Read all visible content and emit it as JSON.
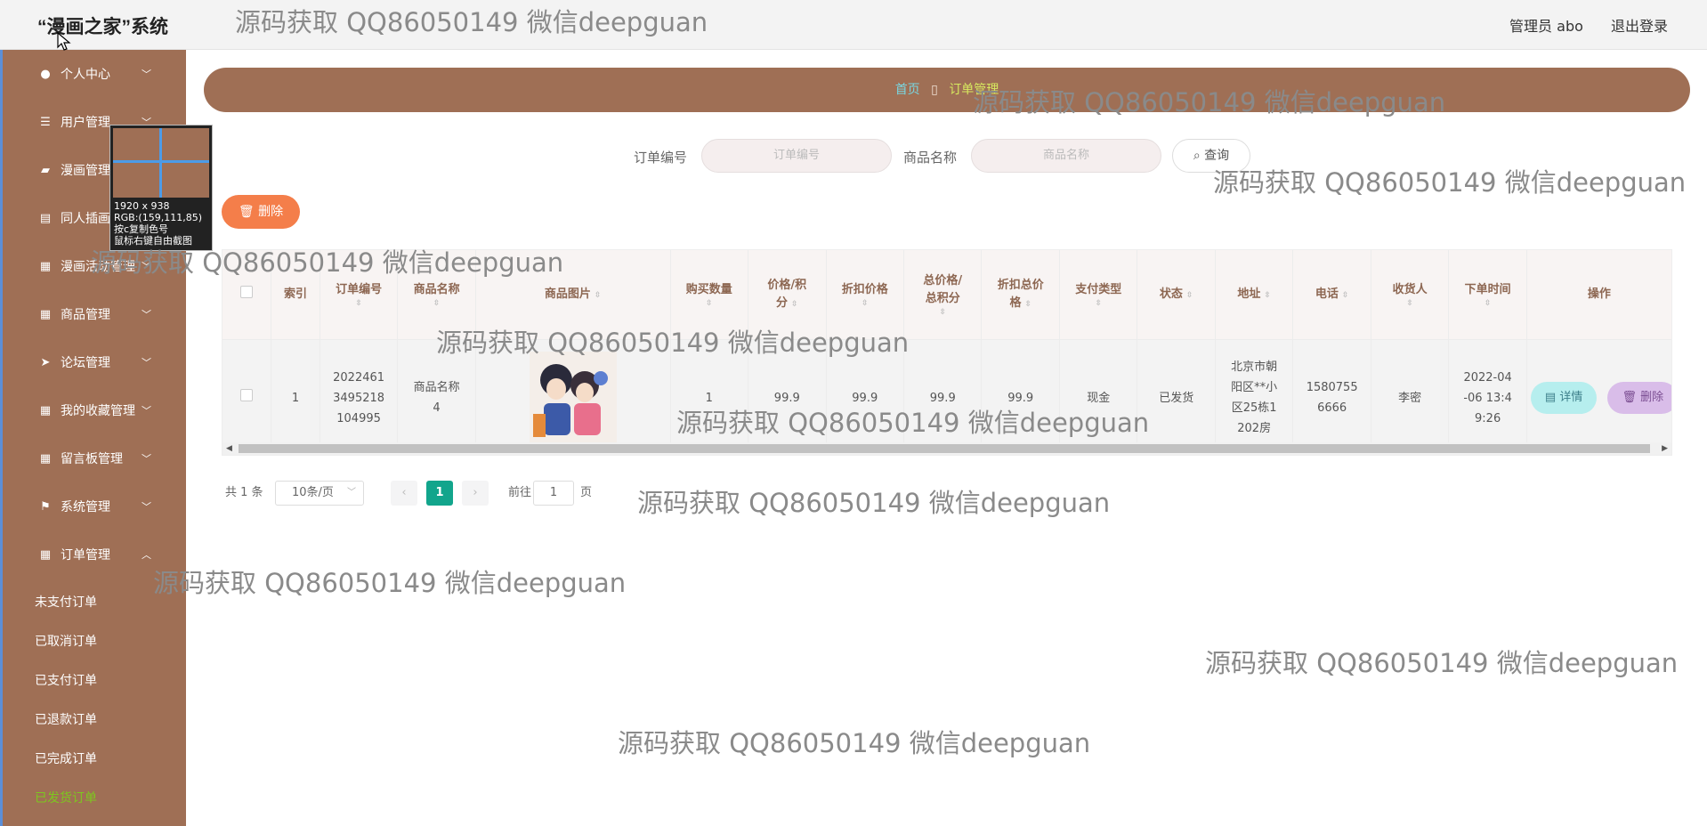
{
  "header": {
    "title": "“漫画之家”系统",
    "user": "管理员 abo",
    "logout": "退出登录"
  },
  "sidebar": {
    "items": [
      {
        "label": "个人中心",
        "icon": "user-icon"
      },
      {
        "label": "用户管理",
        "icon": "sliders-icon"
      },
      {
        "label": "漫画管理",
        "icon": "bookmark-icon"
      },
      {
        "label": "同人插画",
        "icon": "briefcase-icon"
      },
      {
        "label": "漫画活动管理",
        "icon": "grid-icon"
      },
      {
        "label": "商品管理",
        "icon": "grid-icon"
      },
      {
        "label": "论坛管理",
        "icon": "send-icon"
      },
      {
        "label": "我的收藏管理",
        "icon": "grid-icon"
      },
      {
        "label": "留言板管理",
        "icon": "grid-icon"
      },
      {
        "label": "系统管理",
        "icon": "flag-icon"
      },
      {
        "label": "订单管理",
        "icon": "grid-icon"
      }
    ],
    "sub_items": [
      "未支付订单",
      "已取消订单",
      "已支付订单",
      "已退款订单",
      "已完成订单",
      "已发货订单"
    ]
  },
  "tooltip": {
    "size": "1920 x 938",
    "rgb": "RGB:(159,111,85)",
    "hint1": "按c复制色号",
    "hint2": "鼠标右键自由截图"
  },
  "breadcrumb": {
    "home": "首页",
    "sep": "▯",
    "current": "订单管理"
  },
  "search": {
    "order_label": "订单编号",
    "order_placeholder": "订单编号",
    "product_label": "商品名称",
    "product_placeholder": "商品名称",
    "button": "查询"
  },
  "toolbar": {
    "delete": "删除"
  },
  "table": {
    "headers": {
      "index": "索引",
      "order_no": "订单编号",
      "product_name": "商品名称",
      "image": "商品图片",
      "qty": "购买数量",
      "price_line1": "价格/积",
      "price_line2": "分",
      "discount_price": "折扣价格",
      "total_line1": "总价格/",
      "total_line2": "总积分",
      "discount_total_line1": "折扣总价",
      "discount_total_line2": "格",
      "pay_type": "支付类型",
      "status": "状态",
      "address": "地址",
      "phone": "电话",
      "receiver": "收货人",
      "order_time": "下单时间",
      "actions": "操作"
    },
    "rows": [
      {
        "index": "1",
        "order_no_1": "2022461",
        "order_no_2": "3495218",
        "order_no_3": "104995",
        "product_1": "商品名称",
        "product_2": "4",
        "qty": "1",
        "price": "99.9",
        "discount_price": "99.9",
        "total": "99.9",
        "discount_total": "99.9",
        "pay_type": "现金",
        "status": "已发货",
        "addr_1": "北京市朝",
        "addr_2": "阳区**小",
        "addr_3": "区25栋1",
        "addr_4": "202房",
        "phone_1": "1580755",
        "phone_2": "6666",
        "receiver": "李密",
        "time_1": "2022-04",
        "time_2": "-06 13:4",
        "time_3": "9:26",
        "detail_btn": "详情",
        "delete_btn": "删除"
      }
    ]
  },
  "pagination": {
    "total": "共 1 条",
    "page_size": "10条/页",
    "current": "1",
    "goto": "前往",
    "goto_value": "1",
    "unit": "页"
  },
  "watermark": "源码获取 QQ86050149 微信deepguan",
  "colors": {
    "sidebar": "#9f6f55",
    "accent_delete": "#f47e4a",
    "page_active": "#12a58c",
    "sub_active": "#7dc71f"
  }
}
